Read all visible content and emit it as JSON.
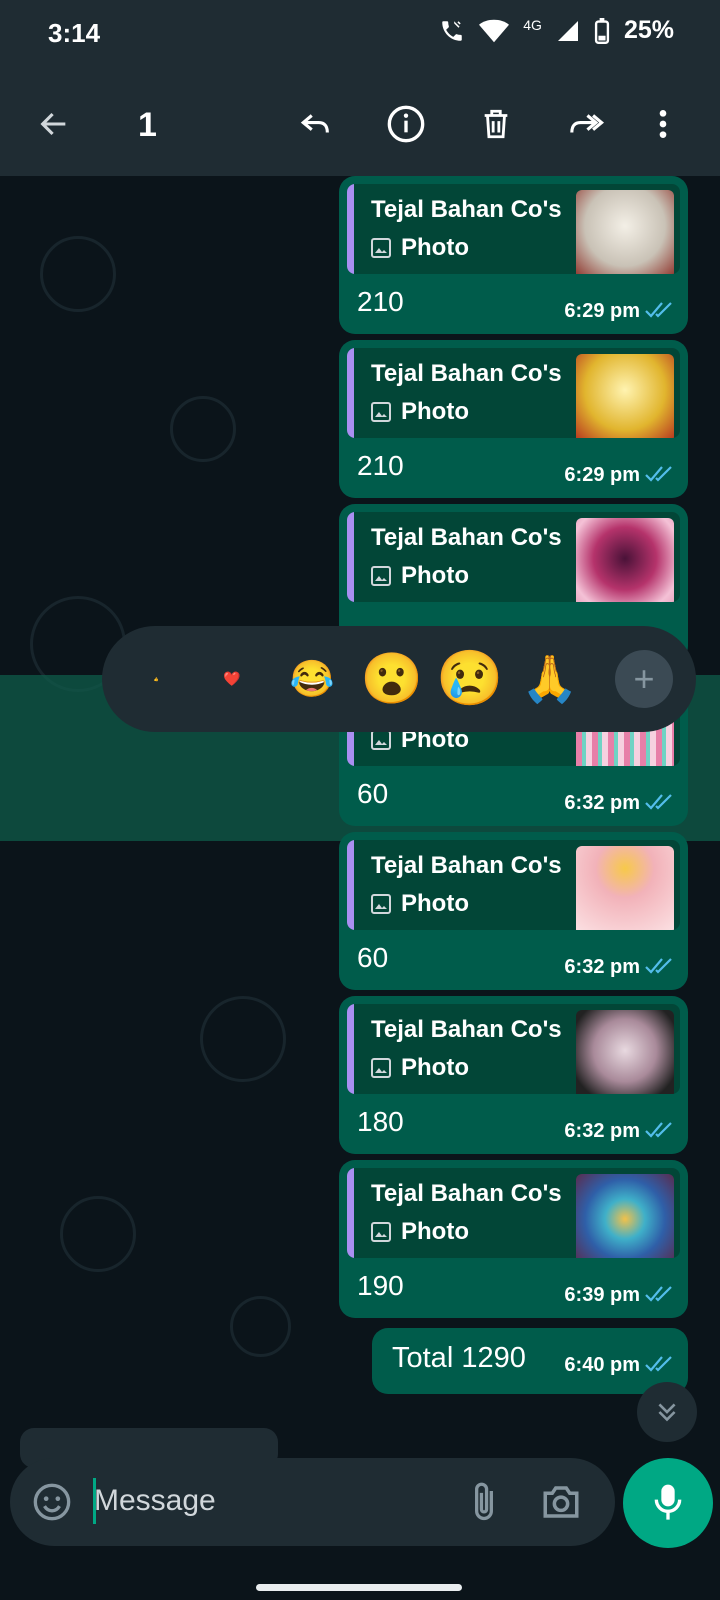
{
  "status_bar": {
    "time": "3:14",
    "network": "4G",
    "battery": "25%"
  },
  "app_bar": {
    "selected_count": "1",
    "icons": [
      "back-arrow-icon",
      "reply-icon",
      "info-icon",
      "delete-icon",
      "forward-icon",
      "more-vert-icon"
    ]
  },
  "messages": [
    {
      "sender": "Tejal Bahan Co's",
      "kind": "Photo",
      "amount": "210",
      "time": "6:29 pm",
      "thumb_color": "#c9c2b6"
    },
    {
      "sender": "Tejal Bahan Co's",
      "kind": "Photo",
      "amount": "210",
      "time": "6:29 pm",
      "thumb_color": "#e1b52e"
    },
    {
      "sender": "Tejal Bahan Co's",
      "kind": "Photo",
      "amount": "",
      "time": "",
      "thumb_color": "#b5336b"
    },
    {
      "sender": "",
      "kind": "Photo",
      "amount": "60",
      "time": "6:32 pm",
      "thumb_color": "#e77fa8"
    },
    {
      "sender": "Tejal Bahan Co's",
      "kind": "Photo",
      "amount": "60",
      "time": "6:32 pm",
      "thumb_color": "#f2b2b9"
    },
    {
      "sender": "Tejal Bahan Co's",
      "kind": "Photo",
      "amount": "180",
      "time": "6:32 pm",
      "thumb_color": "#6d5c66"
    },
    {
      "sender": "Tejal Bahan Co's",
      "kind": "Photo",
      "amount": "190",
      "time": "6:39 pm",
      "thumb_color": "#2f5fa8"
    }
  ],
  "total_message": {
    "text": "Total 1290",
    "time": "6:40 pm"
  },
  "reactions": [
    "👍",
    "❤️",
    "😂",
    "😮",
    "😢",
    "🙏"
  ],
  "reaction_add_label": "+",
  "composer": {
    "placeholder": "Message"
  },
  "colors": {
    "bubble": "#005c4b",
    "quote": "#024637",
    "accent": "#00a884",
    "tick": "#53bdeb",
    "quote_bar": "#a98ff1"
  }
}
